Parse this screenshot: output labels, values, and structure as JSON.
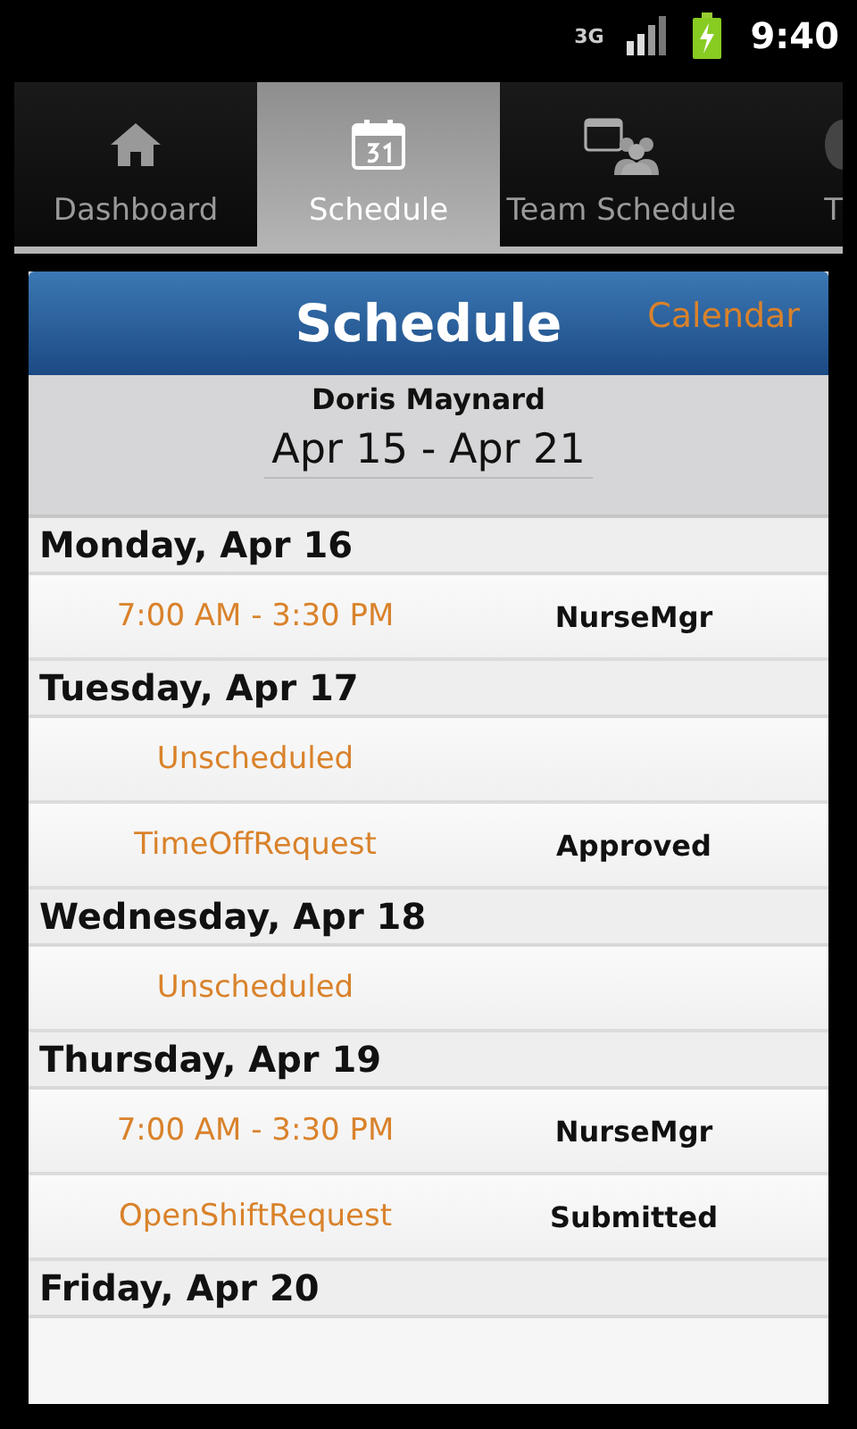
{
  "status_bar": {
    "network": "3G",
    "time": "9:40"
  },
  "tabs": [
    {
      "label": "Dashboard",
      "selected": false
    },
    {
      "label": "Schedule",
      "selected": true
    },
    {
      "label": "Team Schedule",
      "selected": false
    },
    {
      "label": "T",
      "selected": false
    }
  ],
  "header": {
    "title": "Schedule",
    "action": "Calendar"
  },
  "employee": "Doris Maynard",
  "week": "Apr 15 - Apr 21",
  "days": [
    {
      "label": "Monday, Apr 16",
      "entries": [
        {
          "left": "7:00 AM - 3:30 PM",
          "right": "NurseMgr"
        }
      ]
    },
    {
      "label": "Tuesday, Apr 17",
      "entries": [
        {
          "left": "Unscheduled"
        },
        {
          "left": "TimeOffRequest",
          "right": "Approved"
        }
      ]
    },
    {
      "label": "Wednesday, Apr 18",
      "entries": [
        {
          "left": "Unscheduled"
        }
      ]
    },
    {
      "label": "Thursday, Apr 19",
      "entries": [
        {
          "left": "7:00 AM - 3:30 PM",
          "right": "NurseMgr"
        },
        {
          "left": "OpenShiftRequest",
          "right": "Submitted"
        }
      ]
    },
    {
      "label": "Friday, Apr 20"
    }
  ]
}
